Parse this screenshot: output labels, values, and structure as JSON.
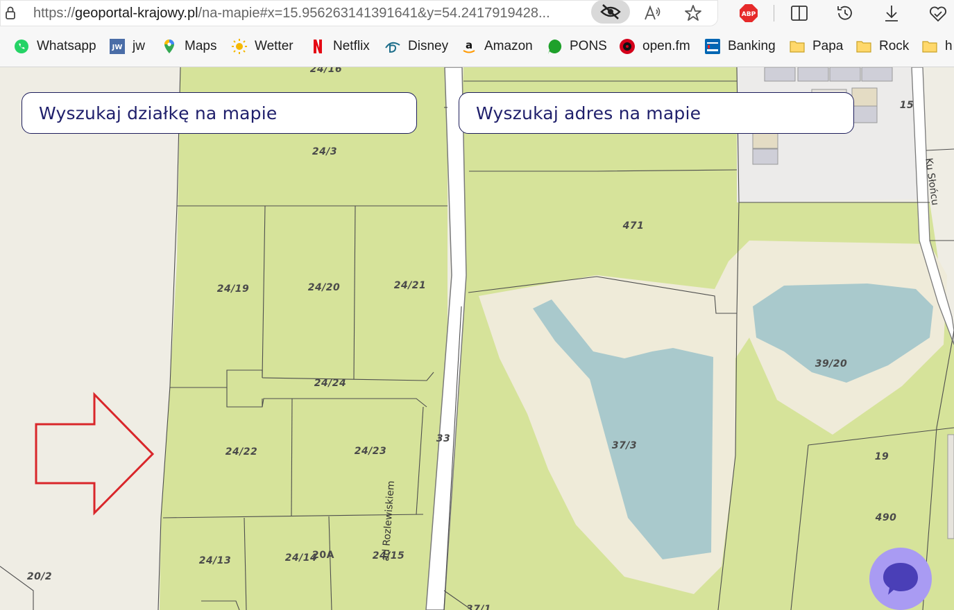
{
  "browser": {
    "url_prefix": "https://",
    "url_host": "geoportal-krajowy.pl",
    "url_rest": "/na-mapie#x=15.956263141391641&y=54.2417919428..."
  },
  "bookmarks": [
    {
      "label": "Whatsapp",
      "icon": "whatsapp-icon",
      "color": "#25d366"
    },
    {
      "label": "jw",
      "icon": "jw-icon",
      "color": "#4a6da7"
    },
    {
      "label": "Maps",
      "icon": "maps-pin-icon",
      "color": "#34a853"
    },
    {
      "label": "Wetter",
      "icon": "sun-icon",
      "color": "#f5b800"
    },
    {
      "label": "Netflix",
      "icon": "netflix-icon",
      "color": "#e50914"
    },
    {
      "label": "Disney",
      "icon": "disney-icon",
      "color": "#1f6f8b"
    },
    {
      "label": "Amazon",
      "icon": "amazon-icon",
      "color": "#000000"
    },
    {
      "label": "PONS",
      "icon": "pons-icon",
      "color": "#1fa12b"
    },
    {
      "label": "open.fm",
      "icon": "openfm-icon",
      "color": "#d4001a"
    },
    {
      "label": "Banking",
      "icon": "bank-icon",
      "color": "#0066b3"
    },
    {
      "label": "Papa",
      "icon": "folder-icon",
      "color": "#f2c94c"
    },
    {
      "label": "Rock",
      "icon": "folder-icon",
      "color": "#f2c94c"
    },
    {
      "label": "h",
      "icon": "folder-icon",
      "color": "#f2c94c"
    }
  ],
  "map": {
    "search_parcel": "Wyszukaj działkę na mapie",
    "search_address": "Wyszukaj adres na mapie",
    "parcels": [
      "24/16",
      "24/3",
      "471",
      "15",
      "24/19",
      "24/20",
      "24/21",
      "24/24",
      "39/20",
      "24/22",
      "24/23",
      "33",
      "37/3",
      "19",
      "490",
      "24/13",
      "24/14",
      "20A",
      "24/15",
      "20/2",
      "37/1"
    ],
    "streets": [
      "ad Rozlewiskiem",
      "Ku Słońcu"
    ]
  },
  "colors": {
    "forest": "#d6e39a",
    "sand": "#efebd9",
    "water": "#a9c9cc",
    "accent": "#1f1f6b",
    "arrow": "#d9262a"
  }
}
